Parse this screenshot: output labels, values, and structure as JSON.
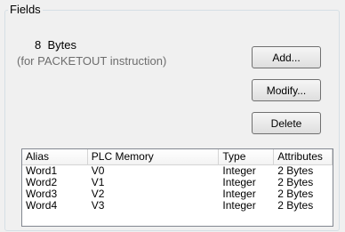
{
  "group": {
    "title": "Fields"
  },
  "info": {
    "size": "8  Bytes",
    "instruction": "(for PACKETOUT instruction)"
  },
  "buttons": {
    "add": "Add...",
    "modify": "Modify...",
    "delete": "Delete"
  },
  "table": {
    "columns": [
      "Alias",
      "PLC Memory",
      "Type",
      "Attributes"
    ],
    "rows": [
      [
        "Word1",
        "V0",
        "Integer",
        "2 Bytes"
      ],
      [
        "Word2",
        "V1",
        "Integer",
        "2 Bytes"
      ],
      [
        "Word3",
        "V2",
        "Integer",
        "2 Bytes"
      ],
      [
        "Word4",
        "V3",
        "Integer",
        "2 Bytes"
      ]
    ]
  }
}
